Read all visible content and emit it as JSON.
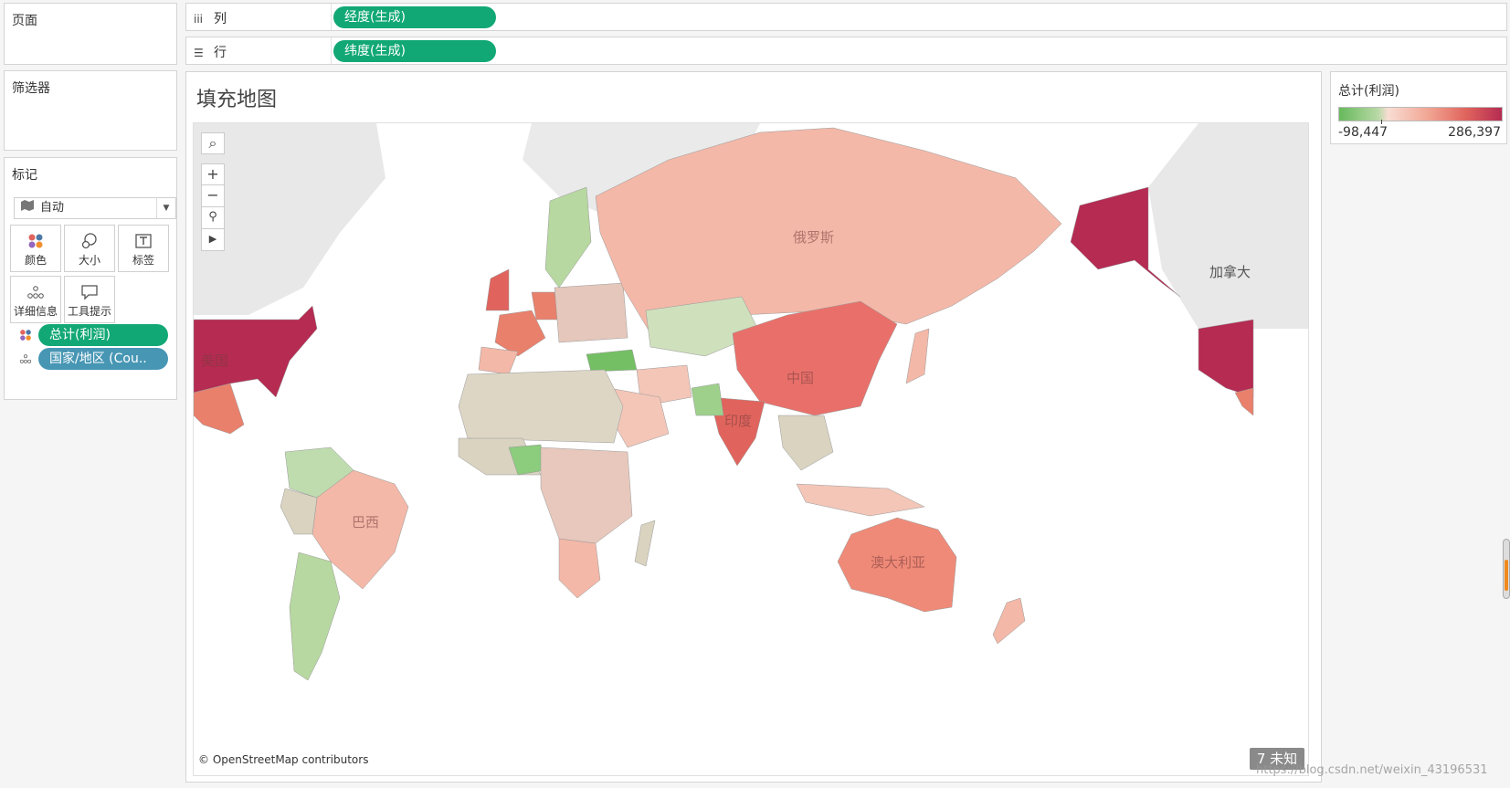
{
  "left_panels": {
    "pages_title": "页面",
    "filters_title": "筛选器",
    "marks_title": "标记",
    "mark_type": "自动",
    "mark_buttons": [
      {
        "label": "颜色",
        "icon": "color-icon"
      },
      {
        "label": "大小",
        "icon": "size-icon"
      },
      {
        "label": "标签",
        "icon": "label-icon"
      },
      {
        "label": "详细信息",
        "icon": "detail-icon"
      },
      {
        "label": "工具提示",
        "icon": "tooltip-icon"
      }
    ],
    "mark_fields": [
      {
        "label": "总计(利润)",
        "icon": "color-icon"
      },
      {
        "label": "国家/地区 (Cou..",
        "icon": "detail-icon"
      }
    ]
  },
  "shelves": {
    "columns": {
      "icon": "columns-icon",
      "label": "列",
      "pill": "经度(生成)"
    },
    "rows": {
      "icon": "rows-icon",
      "label": "行",
      "pill": "纬度(生成)"
    }
  },
  "worksheet": {
    "title": "填充地图",
    "country_labels": [
      "俄罗斯",
      "中国",
      "印度",
      "美国",
      "巴西",
      "澳大利亚",
      "加拿大"
    ],
    "credit": "© OpenStreetMap contributors",
    "unknown_indicator": "7 未知",
    "tools": [
      "search-icon",
      "zoom-in-icon",
      "zoom-out-icon",
      "pin-icon",
      "expand-icon"
    ]
  },
  "legend": {
    "title": "总计(利润)",
    "min": "-98,447",
    "max": "286,397",
    "colors": {
      "low": "#67b95c",
      "mid": "#f8ddd3",
      "high": "#b52b52"
    }
  },
  "watermark": "https://blog.csdn.net/weixin_43196531",
  "colors": {
    "pill_green": "#12a876",
    "pill_blue": "#4796b4"
  }
}
